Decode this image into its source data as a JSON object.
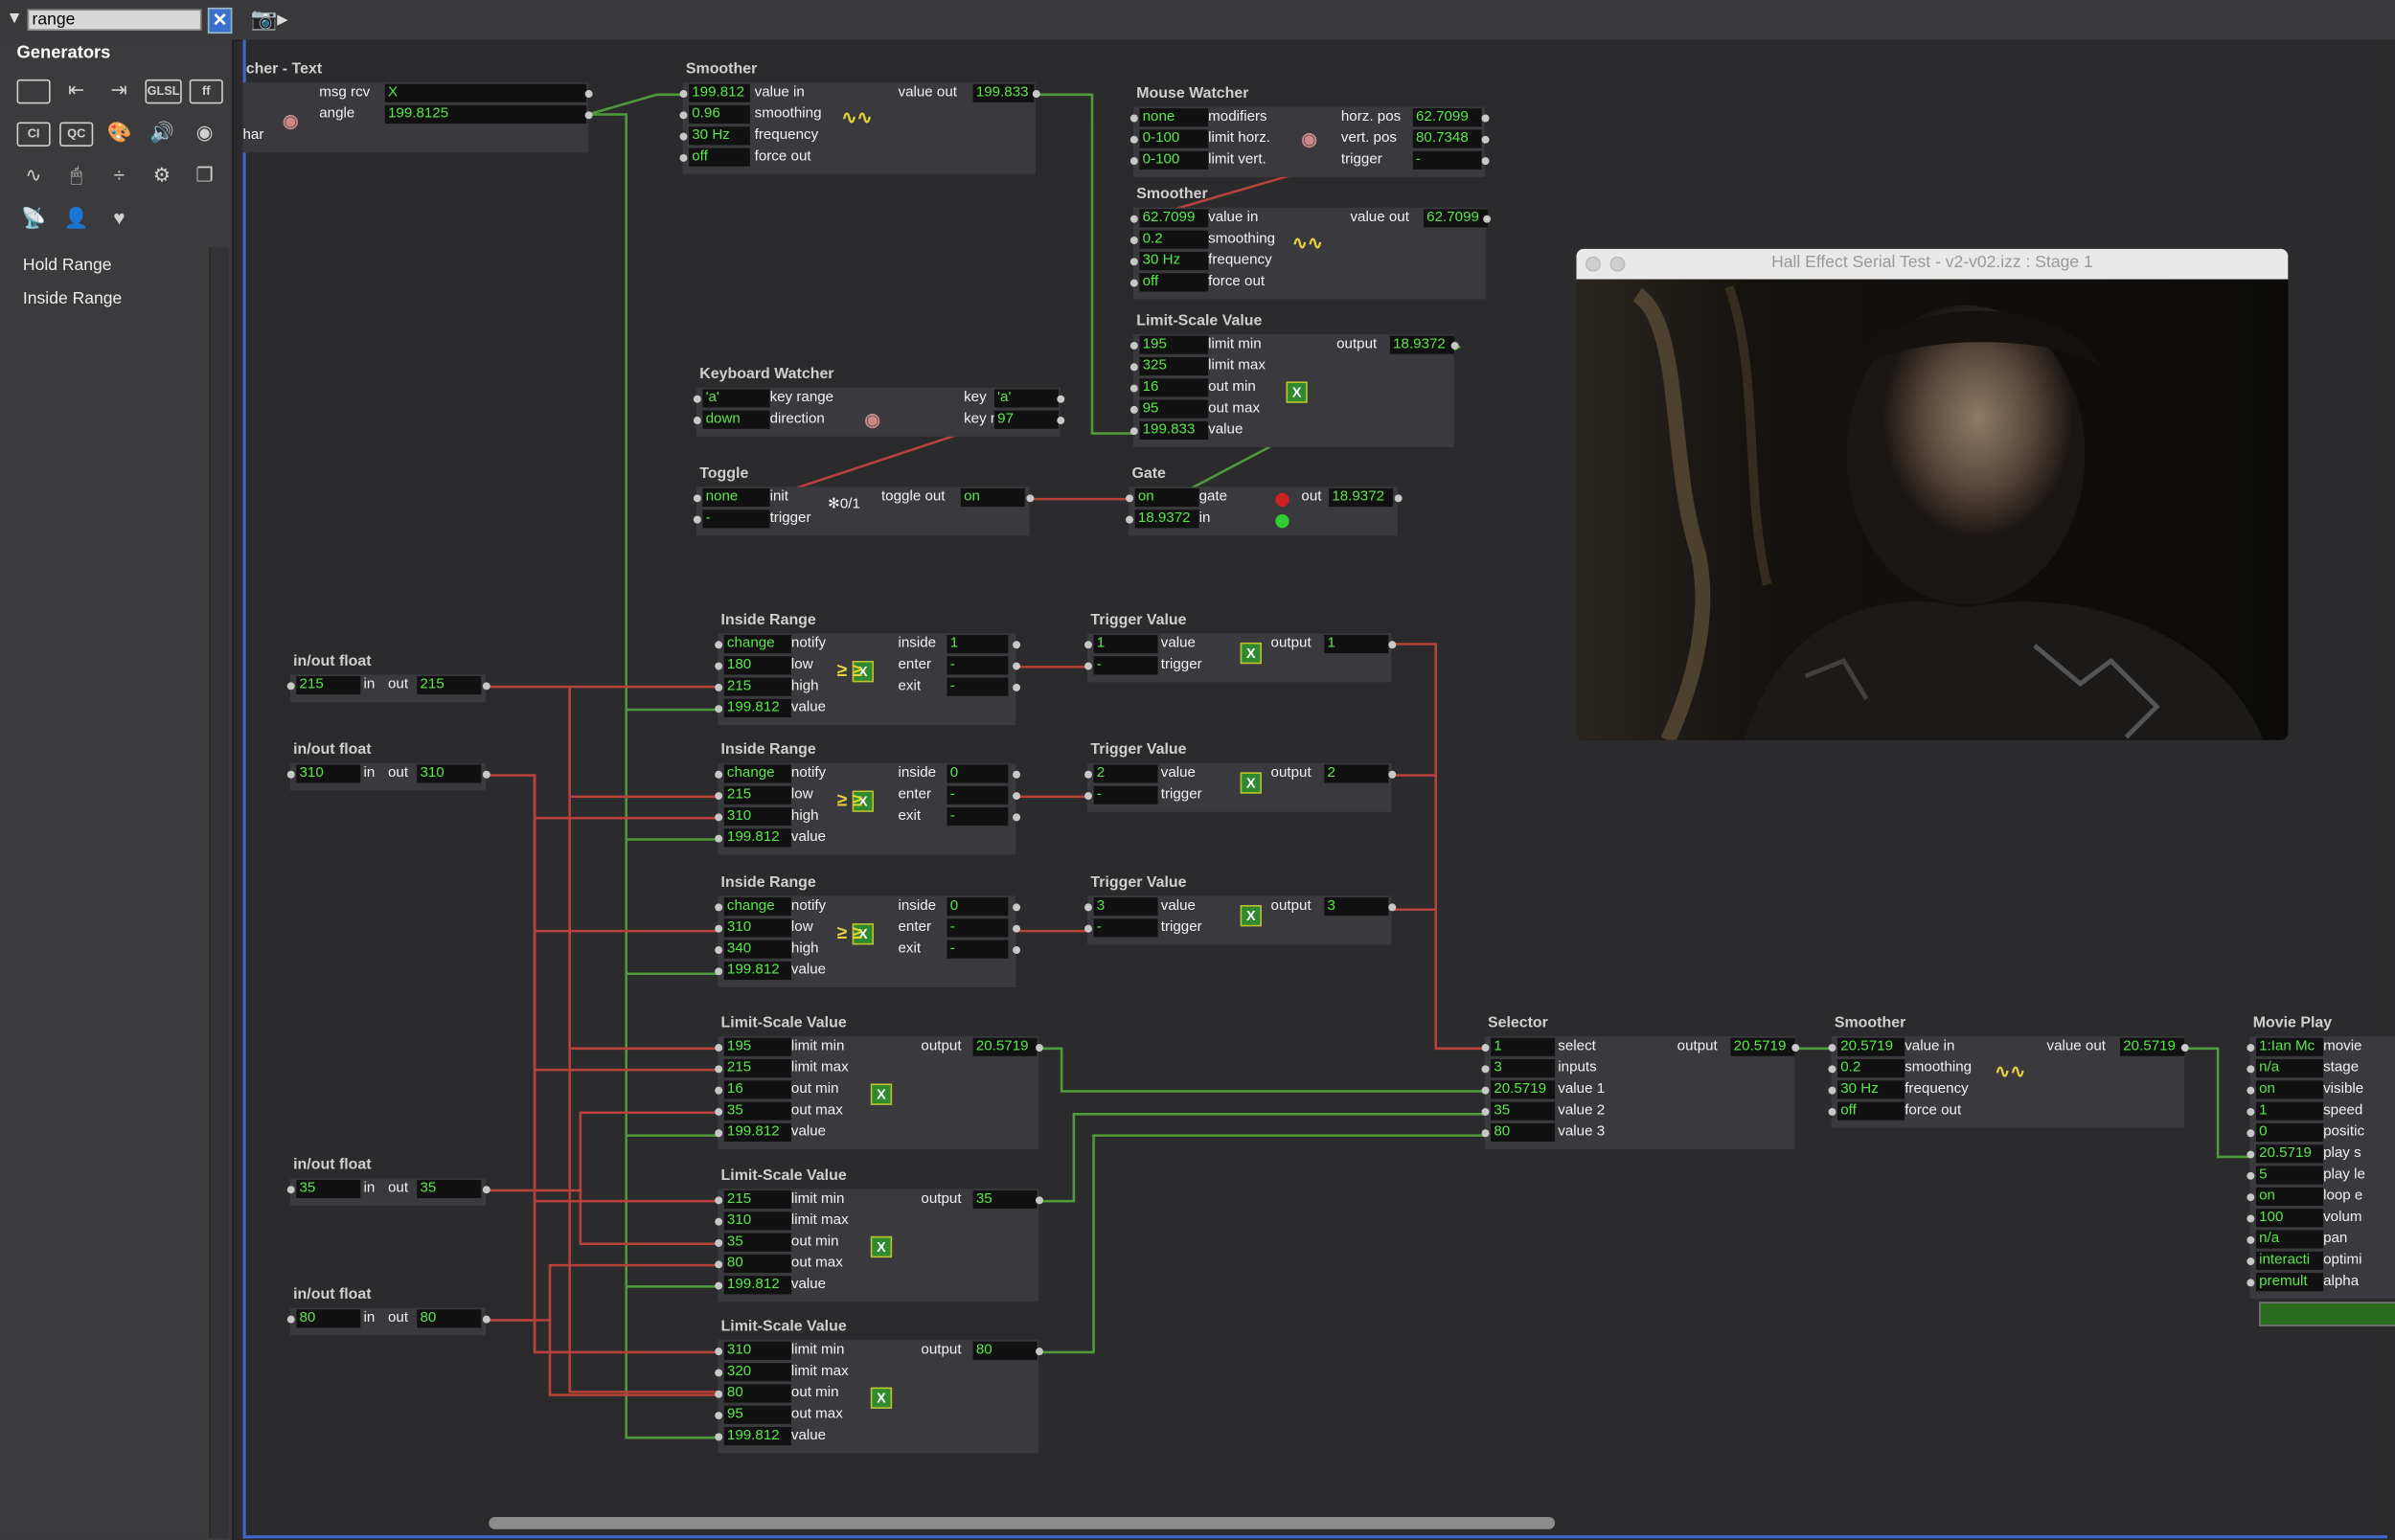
{
  "search": {
    "value": "range"
  },
  "sidebar": {
    "title": "Generators",
    "tool_icons": [
      "rectangle-icon",
      "rect-in-icon",
      "rect-out-icon",
      "glsl-icon",
      "ff-icon",
      "ci-icon",
      "qc-icon",
      "palette-icon",
      "speaker-icon",
      "knob-icon",
      "wave-icon",
      "mouse-icon",
      "divide-icon",
      "gear-icon",
      "windows-icon",
      "antenna-icon",
      "person-icon",
      "heart-icon"
    ],
    "tool_labels": {
      "glsl": "GLSL",
      "ff": "ff",
      "ci": "CI",
      "qc": "QC"
    },
    "items": [
      {
        "label": "Hold Range"
      },
      {
        "label": "Inside Range"
      }
    ]
  },
  "stage": {
    "title": "Hall Effect Serial Test - v2-v02.izz : Stage 1"
  },
  "colors": {
    "wire_green": "#4f9a3a",
    "wire_red": "#b8413a",
    "value_green": "#5ae64a",
    "actor_bg": "#3a3a3e"
  },
  "actors": [
    {
      "id": "watcher-text",
      "title": "cher - Text",
      "rows": [
        {
          "label": "msg rcv",
          "value": "X",
          "vside": "right"
        },
        {
          "label": "angle",
          "value": "199.8125",
          "vside": "right"
        },
        {
          "label": "har",
          "value": "",
          "vside": "none"
        }
      ]
    },
    {
      "id": "smoother-1",
      "title": "Smoother",
      "rows": [
        {
          "value": "199.812",
          "label": "value in",
          "out_label": "value out",
          "out_value": "199.833"
        },
        {
          "value": "0.96",
          "label": "smoothing"
        },
        {
          "value": "30 Hz",
          "label": "frequency"
        },
        {
          "value": "off",
          "label": "force out"
        }
      ]
    },
    {
      "id": "mouse-watcher",
      "title": "Mouse Watcher",
      "rows": [
        {
          "value": "none",
          "label": "modifiers",
          "out_label": "horz. pos",
          "out_value": "62.7099"
        },
        {
          "value": "0-100",
          "label": "limit horz.",
          "out_label": "vert. pos",
          "out_value": "80.7348"
        },
        {
          "value": "0-100",
          "label": "limit vert.",
          "out_label": "trigger",
          "out_value": "-"
        }
      ]
    },
    {
      "id": "smoother-2",
      "title": "Smoother",
      "rows": [
        {
          "value": "62.7099",
          "label": "value in",
          "out_label": "value out",
          "out_value": "62.7099"
        },
        {
          "value": "0.2",
          "label": "smoothing"
        },
        {
          "value": "30 Hz",
          "label": "frequency"
        },
        {
          "value": "off",
          "label": "force out"
        }
      ]
    },
    {
      "id": "limit-scale-top",
      "title": "Limit-Scale Value",
      "rows": [
        {
          "value": "195",
          "label": "limit min",
          "out_label": "output",
          "out_value": "18.9372"
        },
        {
          "value": "325",
          "label": "limit max"
        },
        {
          "value": "16",
          "label": "out min"
        },
        {
          "value": "95",
          "label": "out max"
        },
        {
          "value": "199.833",
          "label": "value"
        }
      ]
    },
    {
      "id": "keyboard-watcher",
      "title": "Keyboard Watcher",
      "rows": [
        {
          "value": "'a'",
          "label": "key range",
          "out_label": "key",
          "out_value": "'a'"
        },
        {
          "value": "down",
          "label": "direction",
          "out_label": "key number",
          "out_value": "97"
        }
      ]
    },
    {
      "id": "toggle",
      "title": "Toggle",
      "rows": [
        {
          "value": "none",
          "label": "init",
          "out_label": "toggle out",
          "out_value": "on"
        },
        {
          "value": "-",
          "label": "trigger"
        }
      ]
    },
    {
      "id": "gate",
      "title": "Gate",
      "rows": [
        {
          "value": "on",
          "label": "gate",
          "out_label": "out",
          "out_value": "18.9372"
        },
        {
          "value": "18.9372",
          "label": "in"
        }
      ]
    },
    {
      "id": "inside-range-1",
      "title": "Inside Range",
      "rows": [
        {
          "value": "change",
          "label": "notify",
          "out_label": "inside",
          "out_value": "1"
        },
        {
          "value": "180",
          "label": "low",
          "out_label": "enter",
          "out_value": "-"
        },
        {
          "value": "215",
          "label": "high",
          "out_label": "exit",
          "out_value": "-"
        },
        {
          "value": "199.812",
          "label": "value"
        }
      ]
    },
    {
      "id": "inside-range-2",
      "title": "Inside Range",
      "rows": [
        {
          "value": "change",
          "label": "notify",
          "out_label": "inside",
          "out_value": "0"
        },
        {
          "value": "215",
          "label": "low",
          "out_label": "enter",
          "out_value": "-"
        },
        {
          "value": "310",
          "label": "high",
          "out_label": "exit",
          "out_value": "-"
        },
        {
          "value": "199.812",
          "label": "value"
        }
      ]
    },
    {
      "id": "inside-range-3",
      "title": "Inside Range",
      "rows": [
        {
          "value": "change",
          "label": "notify",
          "out_label": "inside",
          "out_value": "0"
        },
        {
          "value": "310",
          "label": "low",
          "out_label": "enter",
          "out_value": "-"
        },
        {
          "value": "340",
          "label": "high",
          "out_label": "exit",
          "out_value": "-"
        },
        {
          "value": "199.812",
          "label": "value"
        }
      ]
    },
    {
      "id": "trigger-value-1",
      "title": "Trigger Value",
      "rows": [
        {
          "value": "1",
          "label": "value",
          "out_label": "output",
          "out_value": "1"
        },
        {
          "value": "-",
          "label": "trigger"
        }
      ]
    },
    {
      "id": "trigger-value-2",
      "title": "Trigger Value",
      "rows": [
        {
          "value": "2",
          "label": "value",
          "out_label": "output",
          "out_value": "2"
        },
        {
          "value": "-",
          "label": "trigger"
        }
      ]
    },
    {
      "id": "trigger-value-3",
      "title": "Trigger Value",
      "rows": [
        {
          "value": "3",
          "label": "value",
          "out_label": "output",
          "out_value": "3"
        },
        {
          "value": "-",
          "label": "trigger"
        }
      ]
    },
    {
      "id": "inout-1",
      "title": "in/out float",
      "rows": [
        {
          "value": "215",
          "label": "in",
          "out_label": "out",
          "out_value": "215"
        }
      ]
    },
    {
      "id": "inout-2",
      "title": "in/out float",
      "rows": [
        {
          "value": "310",
          "label": "in",
          "out_label": "out",
          "out_value": "310"
        }
      ]
    },
    {
      "id": "inout-3",
      "title": "in/out float",
      "rows": [
        {
          "value": "35",
          "label": "in",
          "out_label": "out",
          "out_value": "35"
        }
      ]
    },
    {
      "id": "inout-4",
      "title": "in/out float",
      "rows": [
        {
          "value": "80",
          "label": "in",
          "out_label": "out",
          "out_value": "80"
        }
      ]
    },
    {
      "id": "limit-scale-1",
      "title": "Limit-Scale Value",
      "rows": [
        {
          "value": "195",
          "label": "limit min",
          "out_label": "output",
          "out_value": "20.5719"
        },
        {
          "value": "215",
          "label": "limit max"
        },
        {
          "value": "16",
          "label": "out min"
        },
        {
          "value": "35",
          "label": "out max"
        },
        {
          "value": "199.812",
          "label": "value"
        }
      ]
    },
    {
      "id": "limit-scale-2",
      "title": "Limit-Scale Value",
      "rows": [
        {
          "value": "215",
          "label": "limit min",
          "out_label": "output",
          "out_value": "35"
        },
        {
          "value": "310",
          "label": "limit max"
        },
        {
          "value": "35",
          "label": "out min"
        },
        {
          "value": "80",
          "label": "out max"
        },
        {
          "value": "199.812",
          "label": "value"
        }
      ]
    },
    {
      "id": "limit-scale-3",
      "title": "Limit-Scale Value",
      "rows": [
        {
          "value": "310",
          "label": "limit min",
          "out_label": "output",
          "out_value": "80"
        },
        {
          "value": "320",
          "label": "limit max"
        },
        {
          "value": "80",
          "label": "out min"
        },
        {
          "value": "95",
          "label": "out max"
        },
        {
          "value": "199.812",
          "label": "value"
        }
      ]
    },
    {
      "id": "selector",
      "title": "Selector",
      "rows": [
        {
          "value": "1",
          "label": "select",
          "out_label": "output",
          "out_value": "20.5719"
        },
        {
          "value": "3",
          "label": "inputs"
        },
        {
          "value": "20.5719",
          "label": "value 1"
        },
        {
          "value": "35",
          "label": "value 2"
        },
        {
          "value": "80",
          "label": "value 3"
        }
      ]
    },
    {
      "id": "smoother-3",
      "title": "Smoother",
      "rows": [
        {
          "value": "20.5719",
          "label": "value in",
          "out_label": "value out",
          "out_value": "20.5719"
        },
        {
          "value": "0.2",
          "label": "smoothing"
        },
        {
          "value": "30 Hz",
          "label": "frequency"
        },
        {
          "value": "off",
          "label": "force out"
        }
      ]
    },
    {
      "id": "movie-player",
      "title": "Movie Play",
      "rows": [
        {
          "value": "1:Ian Mc",
          "label": "movie"
        },
        {
          "value": "n/a",
          "label": "stage"
        },
        {
          "value": "on",
          "label": "visible"
        },
        {
          "value": "1",
          "label": "speed"
        },
        {
          "value": "0",
          "label": "positic"
        },
        {
          "value": "20.5719",
          "label": "play s"
        },
        {
          "value": "5",
          "label": "play le"
        },
        {
          "value": "on",
          "label": "loop e"
        },
        {
          "value": "100",
          "label": "volum"
        },
        {
          "value": "n/a",
          "label": "pan"
        },
        {
          "value": "interacti",
          "label": "optimi"
        },
        {
          "value": "premult",
          "label": "alpha"
        }
      ]
    }
  ]
}
